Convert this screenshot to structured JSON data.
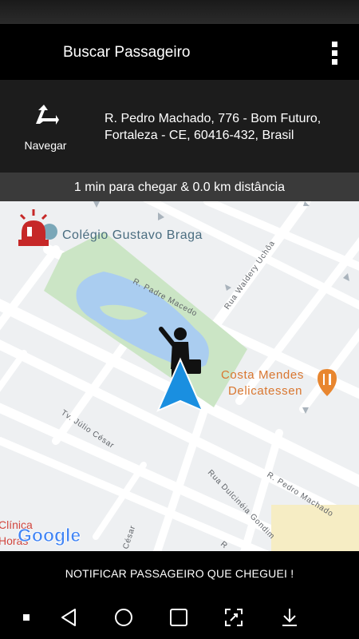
{
  "app": {
    "title": "Buscar Passageiro",
    "menu_icon": "more-vert-icon"
  },
  "navigation": {
    "label": "Navegar",
    "icon": "navigate-arrow-icon",
    "address_line1": "R. Pedro Machado, 776 - Bom Futuro,",
    "address_line2": "Fortaleza - CE, 60416-432, Brasil"
  },
  "eta": {
    "text": "1 min para chegar & 0.0 km distância"
  },
  "map": {
    "labels": {
      "school": "Colégio Gustavo Braga",
      "restaurant_line1": "Costa Mendes",
      "restaurant_line2": "Delicatessen",
      "street_padre_macedo": "R. Padre Macedo",
      "street_waldery": "Rua Waldery Uchôa",
      "street_julio_cesar": "Tv. Júlio César",
      "street_dulcineia": "Rua Dulcinéia Gondim",
      "street_pedro_machado": "R. Pedro Machado",
      "street_cesar": "César",
      "street_partial": "R",
      "clinic_line1": "Clínica",
      "clinic_line2": "Horas",
      "google_logo": "Google"
    },
    "colors": {
      "map_bg": "#eef0f2",
      "road": "#ffffff",
      "park": "#cbe5c5",
      "lake": "#aacdf0",
      "poi_text": "#4a6d80",
      "restaurant": "#d9762f",
      "alarm_red": "#c62828",
      "location_arrow": "#1a8fe0"
    }
  },
  "actions": {
    "notify": "NOTIFICAR PASSAGEIRO QUE CHEGUEI !"
  },
  "system_nav": {
    "dot": "dot-icon",
    "back": "back-triangle-icon",
    "home": "home-circle-icon",
    "recents": "recents-square-icon",
    "screenshot": "screenshot-icon",
    "download": "download-icon"
  }
}
